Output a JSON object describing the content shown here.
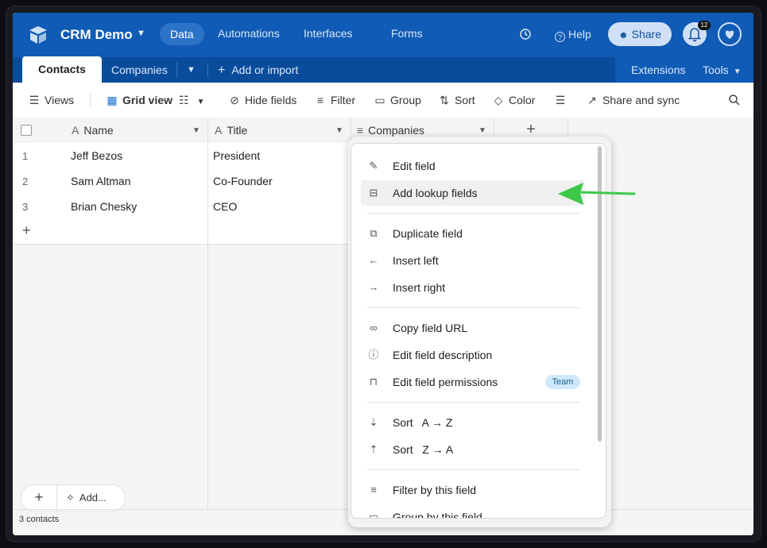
{
  "header": {
    "base_name": "CRM Demo",
    "nav": [
      "Data",
      "Automations",
      "Interfaces",
      "Forms"
    ],
    "help": "Help",
    "share": "Share",
    "notifications": "12"
  },
  "tabs": {
    "active": "Contacts",
    "other": "Companies",
    "add": "Add or import",
    "extensions": "Extensions",
    "tools": "Tools"
  },
  "toolbar": {
    "views": "Views",
    "grid_view": "Grid view",
    "hide_fields": "Hide fields",
    "filter": "Filter",
    "group": "Group",
    "sort": "Sort",
    "color": "Color",
    "share_sync": "Share and sync"
  },
  "grid": {
    "columns": [
      "Name",
      "Title",
      "Companies"
    ],
    "rows": [
      {
        "num": "1",
        "name": "Jeff Bezos",
        "title": "President"
      },
      {
        "num": "2",
        "name": "Sam Altman",
        "title": "Co-Founder"
      },
      {
        "num": "3",
        "name": "Brian Chesky",
        "title": "CEO"
      }
    ],
    "add_label": "Add...",
    "record_count": "3 contacts"
  },
  "menu": {
    "items": [
      {
        "label": "Edit field",
        "icon": "pencil-icon"
      },
      {
        "label": "Add lookup fields",
        "icon": "lookup-icon"
      },
      {
        "label": "Duplicate field",
        "icon": "duplicate-icon"
      },
      {
        "label": "Insert left",
        "icon": "arrow-left-icon"
      },
      {
        "label": "Insert right",
        "icon": "arrow-right-icon"
      },
      {
        "label": "Copy field URL",
        "icon": "link-icon"
      },
      {
        "label": "Edit field description",
        "icon": "info-icon"
      },
      {
        "label": "Edit field permissions",
        "icon": "lock-icon",
        "badge": "Team"
      },
      {
        "label": "Sort   A → Z",
        "icon": "sort-asc-icon"
      },
      {
        "label": "Sort   Z → A",
        "icon": "sort-desc-icon"
      },
      {
        "label": "Filter by this field",
        "icon": "filter-icon"
      },
      {
        "label": "Group by this field",
        "icon": "group-icon"
      }
    ]
  },
  "colors": {
    "topbar": "#0f5bb5",
    "tabbar": "#0a4c9c",
    "arrow": "#3ec84a",
    "badge_bg": "#cfe8fb"
  }
}
